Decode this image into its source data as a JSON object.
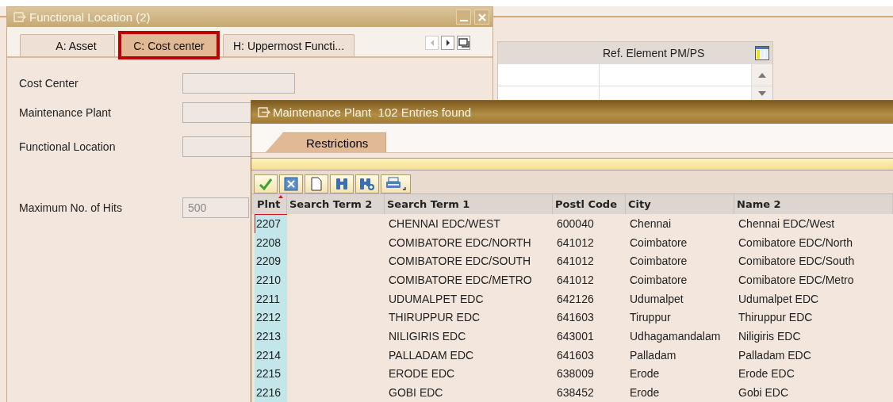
{
  "background_window": {
    "table": {
      "column_2": "Ref. Element PM/PS"
    }
  },
  "functional_location_window": {
    "title": "Functional Location (2)",
    "tabs": [
      {
        "label": "A: Asset",
        "selected": false,
        "highlighted": false
      },
      {
        "label": "C: Cost center",
        "selected": true,
        "highlighted": true
      },
      {
        "label": "H: Uppermost Functi...",
        "selected": false,
        "highlighted": false
      }
    ],
    "fields": [
      {
        "label": "Cost Center"
      },
      {
        "label": "Maintenance Plant"
      },
      {
        "label": "Functional Location"
      },
      {
        "label": "Maximum No. of Hits",
        "value": "500"
      }
    ]
  },
  "maintenance_plant_popup": {
    "title": "Maintenance Plant  102 Entries found",
    "tabs": [
      {
        "label": "Restrictions"
      }
    ],
    "columns": [
      {
        "label": "Plnt",
        "sorted": true
      },
      {
        "label": "Search Term 2",
        "sorted": false
      },
      {
        "label": "Search Term 1",
        "sorted": false
      },
      {
        "label": "Postl Code",
        "sorted": false
      },
      {
        "label": "City",
        "sorted": false
      },
      {
        "label": "Name 2",
        "sorted": false
      }
    ],
    "rows": [
      {
        "plnt": "2207",
        "search_term_1": "CHENNAI EDC/WEST",
        "postal_code": "600040",
        "city": "Chennai",
        "name_2": "Chennai EDC/West",
        "selected": true
      },
      {
        "plnt": "2208",
        "search_term_1": "COMIBATORE EDC/NORTH",
        "postal_code": "641012",
        "city": "Coimbatore",
        "name_2": "Comibatore EDC/North",
        "selected": false
      },
      {
        "plnt": "2209",
        "search_term_1": "COMIBATORE EDC/SOUTH",
        "postal_code": "641012",
        "city": "Coimbatore",
        "name_2": "Comibatore EDC/South",
        "selected": false
      },
      {
        "plnt": "2210",
        "search_term_1": "COMIBATORE EDC/METRO",
        "postal_code": "641012",
        "city": "Coimbatore",
        "name_2": "Comibatore EDC/Metro",
        "selected": false
      },
      {
        "plnt": "2211",
        "search_term_1": "UDUMALPET EDC",
        "postal_code": "642126",
        "city": "Udumalpet",
        "name_2": "Udumalpet EDC",
        "selected": false
      },
      {
        "plnt": "2212",
        "search_term_1": "THIRUPPUR EDC",
        "postal_code": "641603",
        "city": "Tiruppur",
        "name_2": "Thiruppur EDC",
        "selected": false
      },
      {
        "plnt": "2213",
        "search_term_1": "NILIGIRIS EDC",
        "postal_code": "643001",
        "city": "Udhagamandalam",
        "name_2": "Niligiris EDC",
        "selected": false
      },
      {
        "plnt": "2214",
        "search_term_1": "PALLADAM EDC",
        "postal_code": "641603",
        "city": "Palladam",
        "name_2": "Palladam EDC",
        "selected": false
      },
      {
        "plnt": "2215",
        "search_term_1": "ERODE EDC",
        "postal_code": "638009",
        "city": "Erode",
        "name_2": "Erode EDC",
        "selected": false
      },
      {
        "plnt": "2216",
        "search_term_1": "GOBI EDC",
        "postal_code": "638452",
        "city": "Erode",
        "name_2": "Gobi EDC",
        "selected": false
      }
    ]
  }
}
